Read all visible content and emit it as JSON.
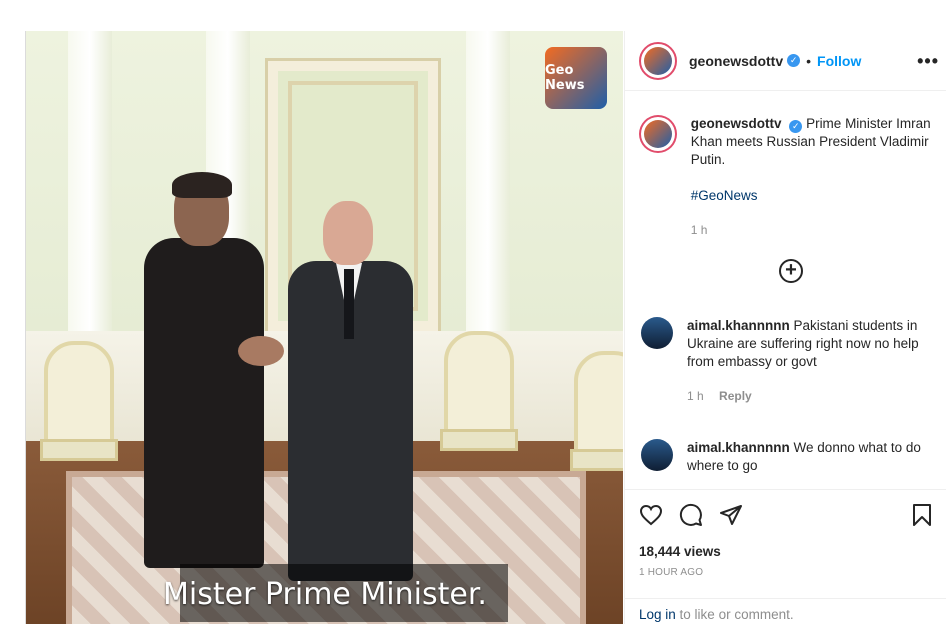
{
  "media": {
    "caption": "Mister Prime Minister.",
    "logo_text": "Geo News"
  },
  "header": {
    "username": "geonewsdottv",
    "separator": "•",
    "follow_label": "Follow",
    "more_icon": "more-options-icon"
  },
  "post_caption": {
    "username": "geonewsdottv",
    "text": "Prime Minister Imran Khan meets Russian President Vladimir Putin.",
    "hashtag": "#GeoNews",
    "age": "1 h"
  },
  "load_more_icon": "plus-circle-icon",
  "comments": [
    {
      "username": "aimal.khannnnn",
      "text": "Pakistani students in Ukraine are suffering right now no help from embassy or govt",
      "age": "1 h",
      "reply_label": "Reply"
    },
    {
      "username": "aimal.khannnnn",
      "text": "We donno what to do where to go"
    }
  ],
  "actions": {
    "like_icon": "heart-icon",
    "comment_icon": "comment-icon",
    "share_icon": "share-icon",
    "save_icon": "bookmark-icon",
    "views": "18,444 views",
    "posted": "1 HOUR AGO"
  },
  "login": {
    "link_label": "Log in",
    "rest": " to like or comment."
  },
  "colors": {
    "accent": "#0095f6",
    "verified": "#3897f0",
    "story_ring": "#e14c6b"
  }
}
